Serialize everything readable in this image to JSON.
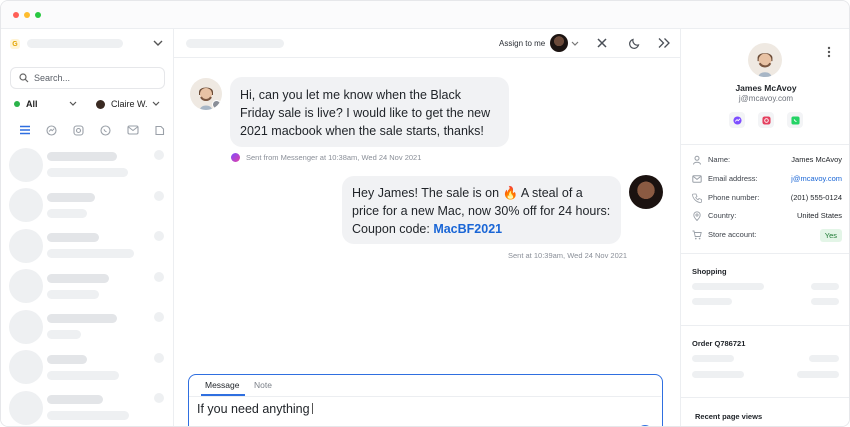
{
  "window": {
    "traffic_lights": [
      "#ff5f57",
      "#febc2e",
      "#28c840"
    ]
  },
  "sidebar": {
    "workspace_badge": "G",
    "search_placeholder": "Search...",
    "filter_status": "All",
    "filter_assignee": "Claire W.",
    "channels": [
      "all-inbox-icon",
      "messenger-icon",
      "instagram-icon",
      "whatsapp-icon",
      "email-icon",
      "other-channel-icon"
    ]
  },
  "chat": {
    "assign_label": "Assign to me",
    "incoming_message": "Hi, can you let me know when the Black Friday sale is live? I would like to get the new 2021 macbook when the sale starts, thanks!",
    "incoming_meta": "Sent from Messenger at 10:38am, Wed 24 Nov 2021",
    "outgoing_text_before": "Hey James! The sale is on 🔥 A steal of a price for a new Mac, now 30% off for 24 hours: Coupon code: ",
    "coupon_code": "MacBF2021",
    "outgoing_meta": "Sent at 10:39am, Wed 24 Nov 2021",
    "composer": {
      "tab_message": "Message",
      "tab_note": "Note",
      "draft": "If you need anything"
    }
  },
  "customer": {
    "name": "James McAvoy",
    "email": "j@mcavoy.com",
    "fields": {
      "name_label": "Name:",
      "name_value": "James McAvoy",
      "email_label": "Email address:",
      "email_value": "j@mcavoy.com",
      "phone_label": "Phone number:",
      "phone_value": "(201) 555-0124",
      "country_label": "Country:",
      "country_value": "United States",
      "store_label": "Store account:",
      "store_value": "Yes"
    },
    "shopping_title": "Shopping",
    "order_title": "Order Q786721",
    "recent_title": "Recent page views"
  },
  "colors": {
    "accent": "#2f6fe0",
    "link": "#1a66d6",
    "success_bg": "#e3f5e7",
    "success_text": "#1f7a35"
  }
}
